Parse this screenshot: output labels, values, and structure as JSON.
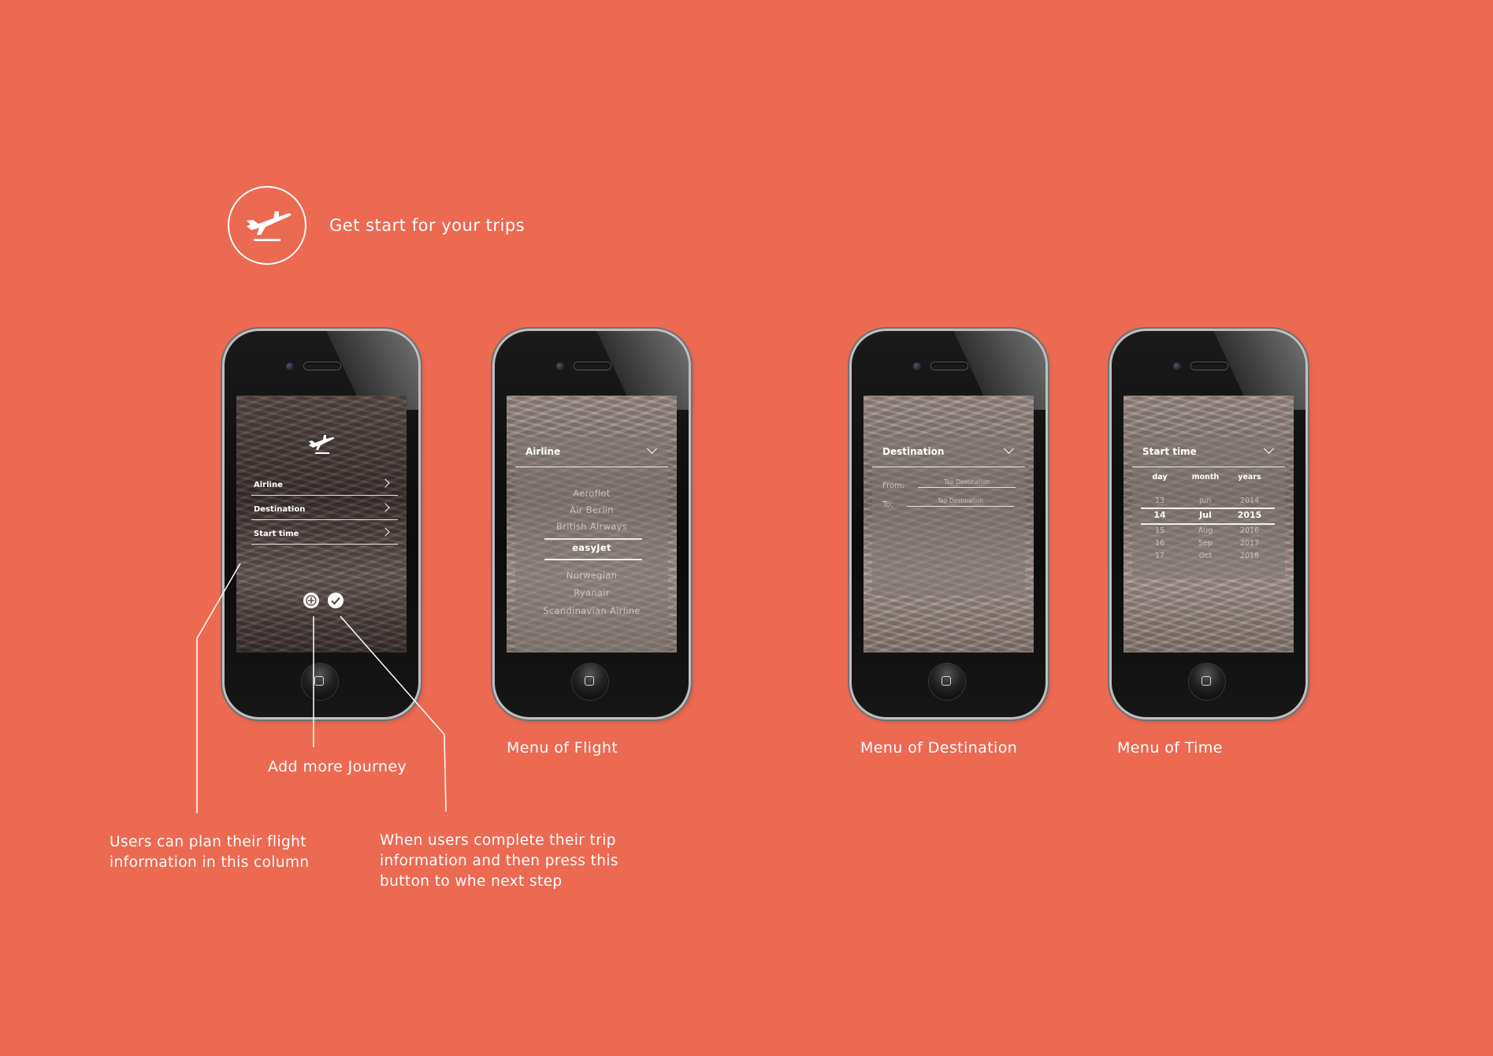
{
  "header": {
    "title": "Get start for your trips",
    "logo_icon": "airplane-takeoff-icon"
  },
  "colors": {
    "background": "#ec6952",
    "text": "#ffffff"
  },
  "phone1": {
    "menu": [
      {
        "label": "Airline"
      },
      {
        "label": "Destination"
      },
      {
        "label": "Start time"
      }
    ],
    "buttons": [
      "add-icon",
      "check-icon"
    ]
  },
  "phone2": {
    "header": "Airline",
    "options": [
      "Aeroflot",
      "Air Berlin",
      "British Airways",
      "easyJet",
      "Norwegian",
      "Ryanair",
      "Scandinavian Airline"
    ],
    "selected": "easyJet"
  },
  "phone3": {
    "header": "Destination",
    "from_label": "From:",
    "to_label": "To:",
    "from_placeholder": "Tap Destination",
    "to_placeholder": "Tap Destination"
  },
  "phone4": {
    "header": "Start time",
    "columns": [
      "day",
      "month",
      "years"
    ],
    "days": [
      "13",
      "14",
      "15",
      "16",
      "17"
    ],
    "months": [
      "Jun",
      "Jul",
      "Aug",
      "Sep",
      "Oct"
    ],
    "years": [
      "2014",
      "2015",
      "2016",
      "2017",
      "2018"
    ],
    "selected_index": 1
  },
  "captions": {
    "flight": "Menu of Flight",
    "destination": "Menu of Destination",
    "time": "Menu of Time",
    "add_journey": "Add more Journey"
  },
  "notes": {
    "plan": [
      "Users can plan their flight",
      "information in this column"
    ],
    "complete": [
      "When users complete their trip",
      "information and then press this",
      "button to whe next step"
    ]
  }
}
